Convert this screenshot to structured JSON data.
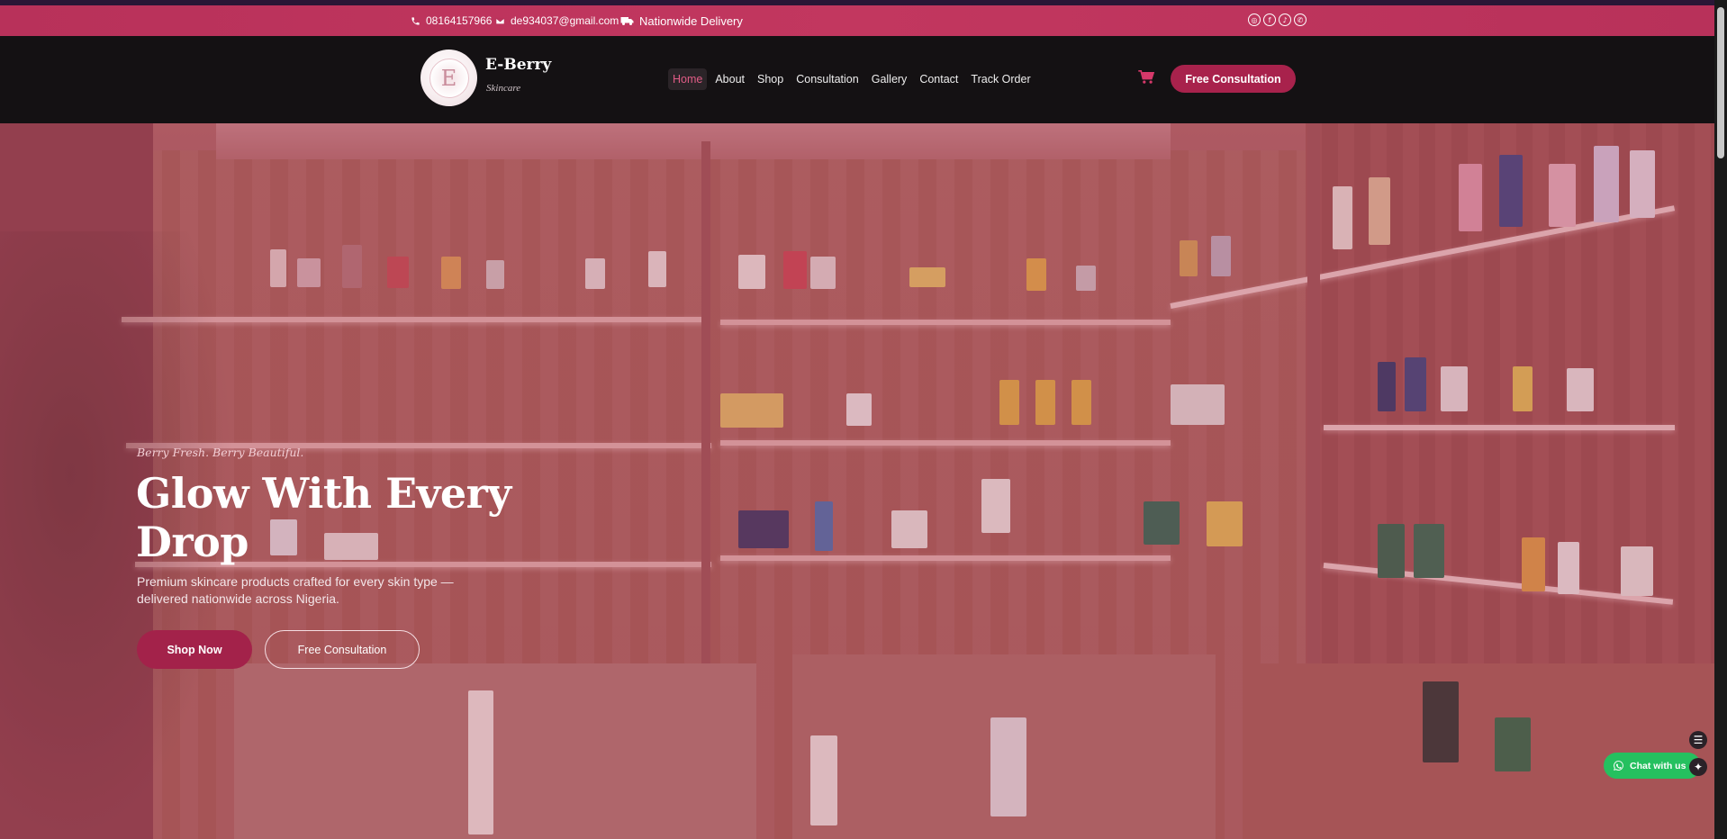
{
  "topbar": {
    "phone": "08164157966",
    "email": "de934037@gmail.com",
    "delivery": "Nationwide Delivery",
    "socials": [
      {
        "icon": "instagram-icon",
        "glyph": "◎"
      },
      {
        "icon": "facebook-icon",
        "glyph": "f"
      },
      {
        "icon": "tiktok-icon",
        "glyph": "♪"
      },
      {
        "icon": "whatsapp-icon",
        "glyph": "✆"
      }
    ]
  },
  "header": {
    "brand_name": "E-Berry",
    "brand_tag": "Skincare",
    "logo_letter": "E",
    "nav": [
      {
        "label": "Home",
        "active": true
      },
      {
        "label": "About"
      },
      {
        "label": "Shop"
      },
      {
        "label": "Consultation"
      },
      {
        "label": "Gallery"
      },
      {
        "label": "Contact"
      },
      {
        "label": "Track Order"
      }
    ],
    "cta_label": "Free Consultation",
    "cart_icon": "cart-icon"
  },
  "hero": {
    "tagline": "Berry Fresh. Berry Beautiful.",
    "title": "Glow With Every Drop",
    "subtitle": "Premium skincare products crafted for every skin type — delivered nationwide across Nigeria.",
    "primary_button": "Shop Now",
    "secondary_button": "Free Consultation"
  },
  "floating": {
    "chat_label": "Chat with us"
  },
  "colors": {
    "brand": "#b8315a",
    "button": "#a3224a",
    "nav_active": "#e05c86",
    "whatsapp": "#25c05f"
  }
}
